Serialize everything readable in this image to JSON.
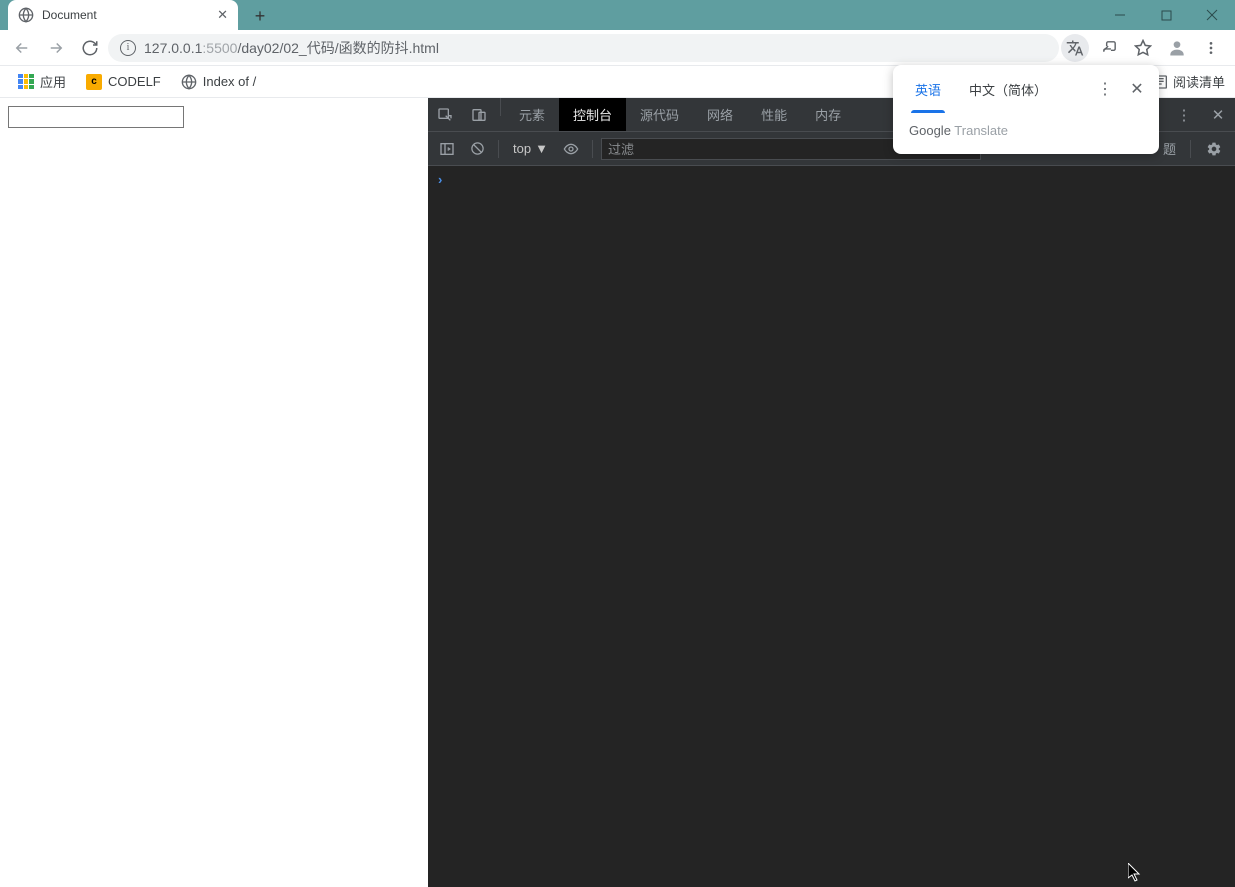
{
  "window": {
    "tab_title": "Document",
    "win_min": "—",
    "win_max": "☐",
    "win_close": "✕"
  },
  "addr": {
    "host": "127.0.0.1",
    "port": ":5500",
    "path": "/day02/02_代码/函数的防抖.html"
  },
  "bookmarks": {
    "apps": "应用",
    "codelf": "CODELF",
    "index_of": "Index of /",
    "reading_list": "阅读清单"
  },
  "page": {
    "input_value": ""
  },
  "devtools": {
    "tabs": {
      "elements": "元素",
      "console": "控制台",
      "sources": "源代码",
      "network": "网络",
      "performance": "性能",
      "memory": "内存"
    },
    "context": "top",
    "filter_placeholder": "过滤",
    "issues_suffix": "题"
  },
  "translate": {
    "english": "英语",
    "chinese": "中文（简体）",
    "brand1": "Google",
    "brand2": " Translate"
  }
}
